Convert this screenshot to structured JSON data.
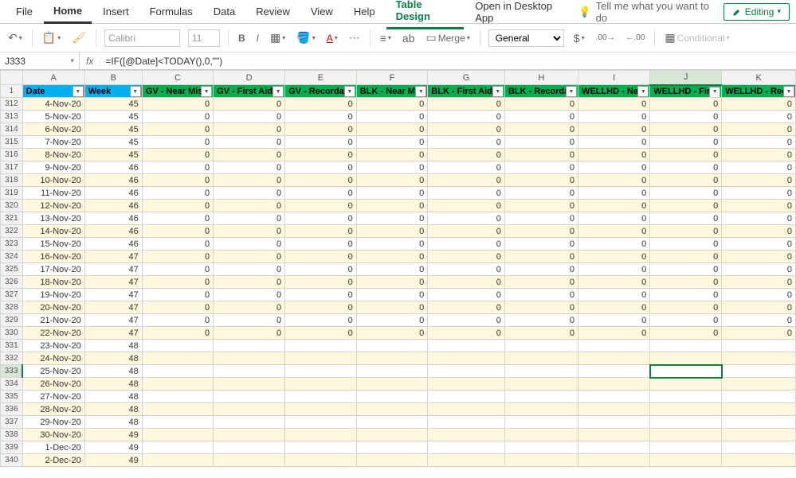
{
  "tabs": {
    "file": "File",
    "home": "Home",
    "insert": "Insert",
    "formulas": "Formulas",
    "data": "Data",
    "review": "Review",
    "view": "View",
    "help": "Help",
    "table_design": "Table Design",
    "open_desktop": "Open in Desktop App",
    "tell_me": "Tell me what you want to do",
    "editing": "Editing"
  },
  "toolbar": {
    "font": "Calibri",
    "size": "11",
    "merge": "Merge",
    "number_format": "General",
    "conditional": "Conditional"
  },
  "formula": {
    "name_box": "J333",
    "value": "=IF([@Date]<TODAY(),0,\"\")"
  },
  "columns": {
    "letters": [
      "A",
      "B",
      "C",
      "D",
      "E",
      "F",
      "G",
      "H",
      "I",
      "J",
      "K"
    ],
    "headers": [
      "Date",
      "Week",
      "GV - Near Miss",
      "GV - First Aid C",
      "GV - Recordabl",
      "BLK - Near Mis",
      "BLK - First Aid C",
      "BLK - Recordab",
      "WELLHD - Near",
      "WELLHD - First",
      "WELLHD - Reco"
    ]
  },
  "selected": {
    "row": 333,
    "col": "J"
  },
  "rows": [
    {
      "n": 312,
      "date": "4-Nov-20",
      "week": 45,
      "v": [
        0,
        0,
        0,
        0,
        0,
        0,
        0,
        0,
        0
      ]
    },
    {
      "n": 313,
      "date": "5-Nov-20",
      "week": 45,
      "v": [
        0,
        0,
        0,
        0,
        0,
        0,
        0,
        0,
        0
      ]
    },
    {
      "n": 314,
      "date": "6-Nov-20",
      "week": 45,
      "v": [
        0,
        0,
        0,
        0,
        0,
        0,
        0,
        0,
        0
      ]
    },
    {
      "n": 315,
      "date": "7-Nov-20",
      "week": 45,
      "v": [
        0,
        0,
        0,
        0,
        0,
        0,
        0,
        0,
        0
      ]
    },
    {
      "n": 316,
      "date": "8-Nov-20",
      "week": 45,
      "v": [
        0,
        0,
        0,
        0,
        0,
        0,
        0,
        0,
        0
      ]
    },
    {
      "n": 317,
      "date": "9-Nov-20",
      "week": 46,
      "v": [
        0,
        0,
        0,
        0,
        0,
        0,
        0,
        0,
        0
      ]
    },
    {
      "n": 318,
      "date": "10-Nov-20",
      "week": 46,
      "v": [
        0,
        0,
        0,
        0,
        0,
        0,
        0,
        0,
        0
      ]
    },
    {
      "n": 319,
      "date": "11-Nov-20",
      "week": 46,
      "v": [
        0,
        0,
        0,
        0,
        0,
        0,
        0,
        0,
        0
      ]
    },
    {
      "n": 320,
      "date": "12-Nov-20",
      "week": 46,
      "v": [
        0,
        0,
        0,
        0,
        0,
        0,
        0,
        0,
        0
      ]
    },
    {
      "n": 321,
      "date": "13-Nov-20",
      "week": 46,
      "v": [
        0,
        0,
        0,
        0,
        0,
        0,
        0,
        0,
        0
      ]
    },
    {
      "n": 322,
      "date": "14-Nov-20",
      "week": 46,
      "v": [
        0,
        0,
        0,
        0,
        0,
        0,
        0,
        0,
        0
      ]
    },
    {
      "n": 323,
      "date": "15-Nov-20",
      "week": 46,
      "v": [
        0,
        0,
        0,
        0,
        0,
        0,
        0,
        0,
        0
      ]
    },
    {
      "n": 324,
      "date": "16-Nov-20",
      "week": 47,
      "v": [
        0,
        0,
        0,
        0,
        0,
        0,
        0,
        0,
        0
      ]
    },
    {
      "n": 325,
      "date": "17-Nov-20",
      "week": 47,
      "v": [
        0,
        0,
        0,
        0,
        0,
        0,
        0,
        0,
        0
      ]
    },
    {
      "n": 326,
      "date": "18-Nov-20",
      "week": 47,
      "v": [
        0,
        0,
        0,
        0,
        0,
        0,
        0,
        0,
        0
      ]
    },
    {
      "n": 327,
      "date": "19-Nov-20",
      "week": 47,
      "v": [
        0,
        0,
        0,
        0,
        0,
        0,
        0,
        0,
        0
      ]
    },
    {
      "n": 328,
      "date": "20-Nov-20",
      "week": 47,
      "v": [
        0,
        0,
        0,
        0,
        0,
        0,
        0,
        0,
        0
      ]
    },
    {
      "n": 329,
      "date": "21-Nov-20",
      "week": 47,
      "v": [
        0,
        0,
        0,
        0,
        0,
        0,
        0,
        0,
        0
      ]
    },
    {
      "n": 330,
      "date": "22-Nov-20",
      "week": 47,
      "v": [
        0,
        0,
        0,
        0,
        0,
        0,
        0,
        0,
        0
      ]
    },
    {
      "n": 331,
      "date": "23-Nov-20",
      "week": 48,
      "v": null
    },
    {
      "n": 332,
      "date": "24-Nov-20",
      "week": 48,
      "v": null
    },
    {
      "n": 333,
      "date": "25-Nov-20",
      "week": 48,
      "v": null
    },
    {
      "n": 334,
      "date": "26-Nov-20",
      "week": 48,
      "v": null
    },
    {
      "n": 335,
      "date": "27-Nov-20",
      "week": 48,
      "v": null
    },
    {
      "n": 336,
      "date": "28-Nov-20",
      "week": 48,
      "v": null
    },
    {
      "n": 337,
      "date": "29-Nov-20",
      "week": 48,
      "v": null
    },
    {
      "n": 338,
      "date": "30-Nov-20",
      "week": 49,
      "v": null
    },
    {
      "n": 339,
      "date": "1-Dec-20",
      "week": 49,
      "v": null
    },
    {
      "n": 340,
      "date": "2-Dec-20",
      "week": 49,
      "v": null
    }
  ]
}
